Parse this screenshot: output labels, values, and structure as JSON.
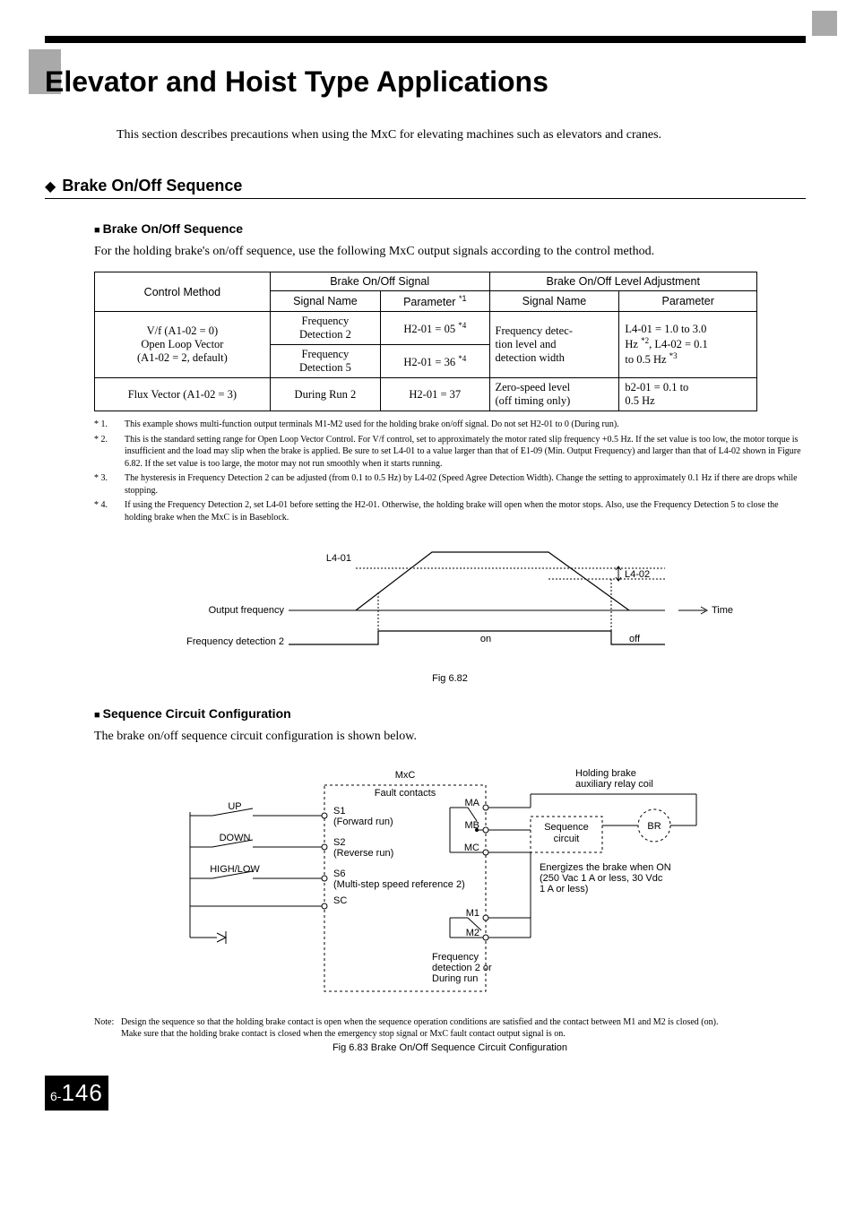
{
  "title": "Elevator and Hoist Type Applications",
  "intro": "This section describes precautions when using the MxC for elevating machines such as elevators and cranes.",
  "section1": {
    "heading": "Brake On/Off Sequence",
    "sub1_heading": "Brake On/Off Sequence",
    "sub1_body": "For the holding brake's on/off sequence, use the following MxC output signals according to the control method.",
    "table": {
      "head_control": "Control Method",
      "head_signal": "Brake On/Off Signal",
      "head_level": "Brake On/Off Level Adjustment",
      "head_signame": "Signal Name",
      "head_param": "Parameter ",
      "head_param_sup": "*1",
      "head_signame2": "Signal Name",
      "head_param2": "Parameter",
      "r1_cm_a": "V/f (A1-02 = 0)",
      "r1_cm_b": "Open Loop Vector",
      "r1_cm_c": "(A1-02 = 2, default)",
      "r1_sn_a": "Frequency",
      "r1_sn_b": "Detection 2",
      "r1_pm": "H2-01 = 05 ",
      "r1_pm_sup": "*4",
      "r2_sn_a": "Frequency",
      "r2_sn_b": "Detection 5",
      "r2_pm": "H2-01 = 36 ",
      "r2_pm_sup": "*4",
      "r12_sn2_a": "Frequency detec-",
      "r12_sn2_b": "tion level and",
      "r12_sn2_c": "detection width",
      "r12_pm2_a": "L4-01 = 1.0 to 3.0",
      "r12_pm2_b_pre": "Hz ",
      "r12_pm2_b_sup": "*2",
      "r12_pm2_b_post": ", L4-02 = 0.1",
      "r12_pm2_c_pre": "to 0.5 Hz ",
      "r12_pm2_c_sup": "*3",
      "r3_cm": "Flux Vector (A1-02 = 3)",
      "r3_sn": "During Run 2",
      "r3_pm": "H2-01 = 37",
      "r3_sn2_a": "Zero-speed level",
      "r3_sn2_b": "(off timing only)",
      "r3_pm2_a": "b2-01 = 0.1 to",
      "r3_pm2_b": "0.5 Hz"
    },
    "footnotes": {
      "f1_num": "*  1.",
      "f1": "This example shows multi-function output terminals M1-M2 used for the holding brake on/off signal. Do not set H2-01 to 0 (During run).",
      "f2_num": "*  2.",
      "f2": "This is the standard setting range for Open Loop Vector Control. For V/f control, set to approximately the motor rated slip frequency +0.5 Hz. If the set value is too low, the motor torque is insufficient and the load may slip when the brake is applied. Be sure to set L4-01 to a value larger than that of E1-09 (Min. Output Frequency) and larger than that of L4-02 shown in Figure 6.82. If the set value is too large, the motor may not run smoothly when it starts running.",
      "f3_num": "*  3.",
      "f3": "The hysteresis in Frequency Detection 2 can be adjusted (from 0.1 to 0.5 Hz) by L4-02 (Speed Agree Detection Width). Change the setting to approximately 0.1 Hz if there are drops while stopping.",
      "f4_num": "*  4.",
      "f4": "If using the Frequency Detection 2, set L4-01 before setting the H2-01. Otherwise, the holding brake will open when the motor stops. Also, use the Frequency Detection 5 to close the holding brake when the MxC is in Baseblock."
    },
    "diag1": {
      "l401": "L4-01",
      "l402": "L4-02",
      "out_freq": "Output frequency",
      "freq_det": "Frequency detection 2",
      "time": "Time",
      "on": "on",
      "off": "off",
      "caption": "Fig 6.82"
    },
    "sub2_heading": "Sequence Circuit Configuration",
    "sub2_body": "The brake on/off sequence circuit configuration is shown below.",
    "diag2": {
      "mxc": "MxC",
      "fault": "Fault contacts",
      "up": "UP",
      "down": "DOWN",
      "hl": "HIGH/LOW",
      "s1": "S1",
      "s1d": "(Forward run)",
      "s2": "S2",
      "s2d": "(Reverse run)",
      "s6": "S6",
      "s6d": "(Multi-step speed reference 2)",
      "sc": "SC",
      "ma": "MA",
      "mb": "MB",
      "mc": "MC",
      "m1": "M1",
      "m2": "M2",
      "seq": "Sequence",
      "circuit": "circuit",
      "br": "BR",
      "hb1": "Holding brake",
      "hb2": "auxiliary relay coil",
      "en1": "Energizes the brake when ON",
      "en2": "(250 Vac 1 A or less, 30 Vdc",
      "en3": "1 A or less)",
      "fd1": "Frequency",
      "fd2": "detection 2 or",
      "fd3": "During run",
      "caption": "Fig 6.83  Brake On/Off Sequence Circuit Configuration"
    },
    "note_lead": "Note: ",
    "note1": "Design the sequence so that the holding brake contact is open when the sequence operation conditions are satisfied and the contact between M1 and M2 is closed (on).",
    "note2": "Make sure that the holding brake contact is closed when the emergency stop signal or MxC fault contact output signal is on."
  },
  "page": {
    "chapter": "6-",
    "num": "146"
  }
}
